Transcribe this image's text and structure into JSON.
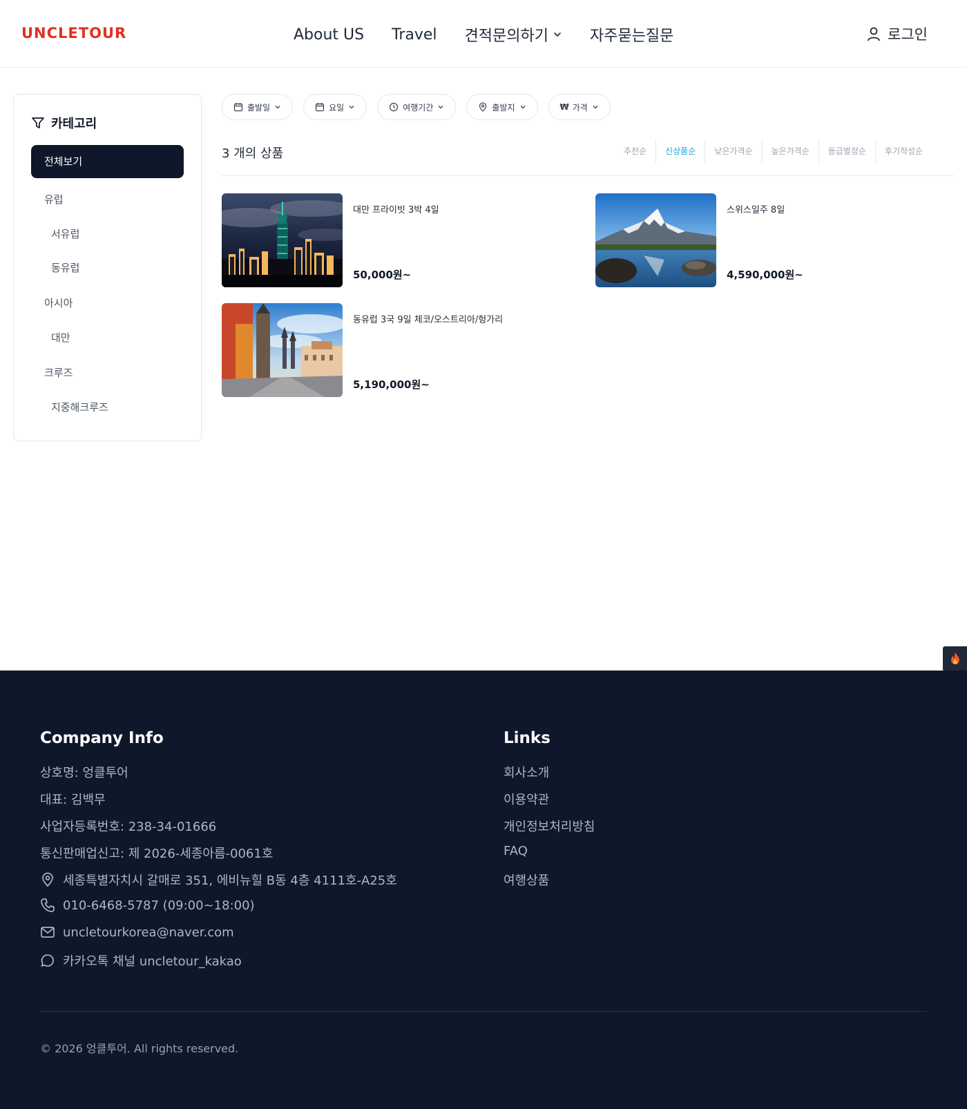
{
  "header": {
    "logo": "UNCLETOUR",
    "nav": [
      "About US",
      "Travel",
      "견적문의하기",
      "자주묻는질문"
    ],
    "login": "로그인"
  },
  "sidebar": {
    "title": "카테고리",
    "all": "전체보기",
    "items": [
      "유럽",
      "서유럽",
      "동유럽",
      "아시아",
      "대만",
      "크루즈",
      "지중해크루즈"
    ]
  },
  "filters": [
    "출발일",
    "요일",
    "여행기간",
    "출발지",
    "가격"
  ],
  "results": {
    "count": "3 개의 상품",
    "sorts": [
      "추천순",
      "신상품순",
      "낮은가격순",
      "높은가격순",
      "등급별정순",
      "후기작성순"
    ],
    "active_sort": "신상품순"
  },
  "products": [
    {
      "name": "대만 프라이빗 3박 4일",
      "price": "50,000원~",
      "image": "taipei-night-skyline"
    },
    {
      "name": "스위스일주 8일",
      "price": "4,590,000원~",
      "image": "matterhorn-lake"
    },
    {
      "name": "동유럽 3국 9일 체코/오스트리아/헝가리",
      "price": "5,190,000원~",
      "image": "prague-old-town"
    }
  ],
  "footer": {
    "company_title": "Company Info",
    "company": [
      "상호명: 엉클투어",
      "대표: 김백무",
      "사업자등록번호: 238-34-01666",
      "통신판매업신고: 제 2026-세종아름-0061호"
    ],
    "address": "세종특별자치시 갈매로 351, 에비뉴힐 B동 4층 4111호-A25호",
    "phone": "010-6468-5787 (09:00~18:00)",
    "email": "uncletourkorea@naver.com",
    "kakao": "카카오톡 채널 uncletour_kakao",
    "links_title": "Links",
    "links": [
      "회사소개",
      "이용약관",
      "개인정보처리방침",
      "FAQ",
      "여행상품"
    ],
    "copyright": "© 2026 엉클투어. All rights reserved."
  },
  "colors": {
    "brand": "#e0301e",
    "accent": "#0ea5e9",
    "dark": "#0f172a"
  }
}
